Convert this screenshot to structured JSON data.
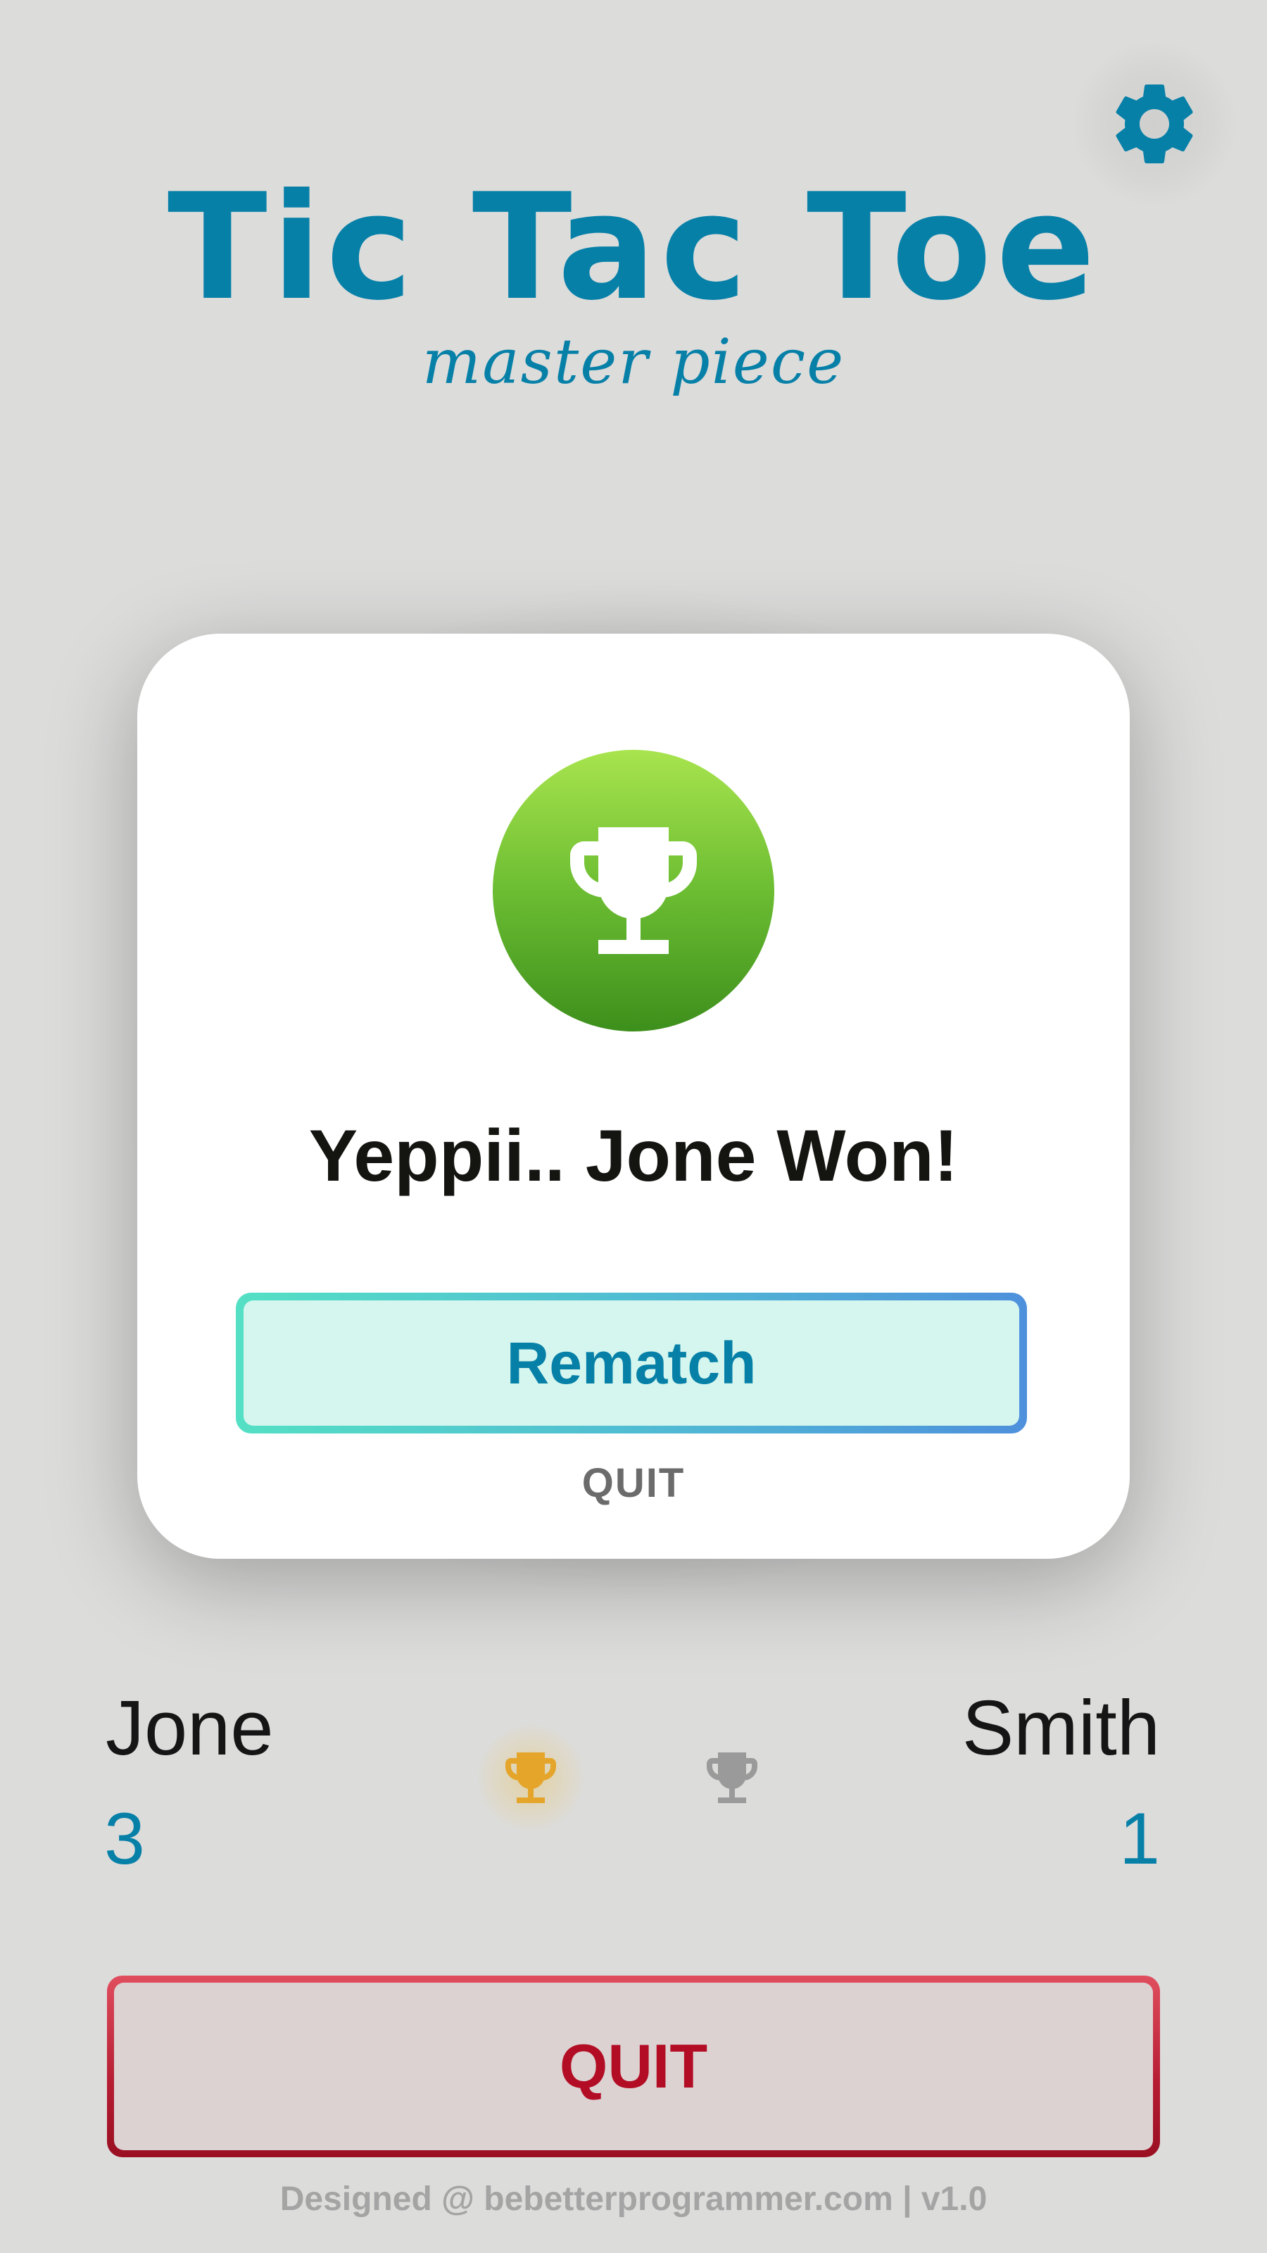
{
  "header": {
    "title": "Tic Tac Toe",
    "subtitle": "master piece",
    "settings_icon": "gear-icon"
  },
  "modal": {
    "icon": "trophy-icon",
    "message": "Yeppii.. Jone Won!",
    "rematch_label": "Rematch",
    "quit_label": "QUIT"
  },
  "scoreboard": {
    "player1": {
      "name": "Jone",
      "score": "3"
    },
    "player2": {
      "name": "Smith",
      "score": "1"
    },
    "icons": [
      "trophy-gold-icon",
      "trophy-grey-icon"
    ]
  },
  "quit_button": {
    "label": "QUIT"
  },
  "footer": {
    "text": "Designed @ bebetterprogrammer.com | v1.0"
  },
  "colors": {
    "accent": "#0780a8",
    "win_green": "#6cbd32",
    "danger": "#b20d24",
    "gold": "#e4a52a",
    "grey": "#9a9a9a",
    "background": "#dcdcdb"
  }
}
